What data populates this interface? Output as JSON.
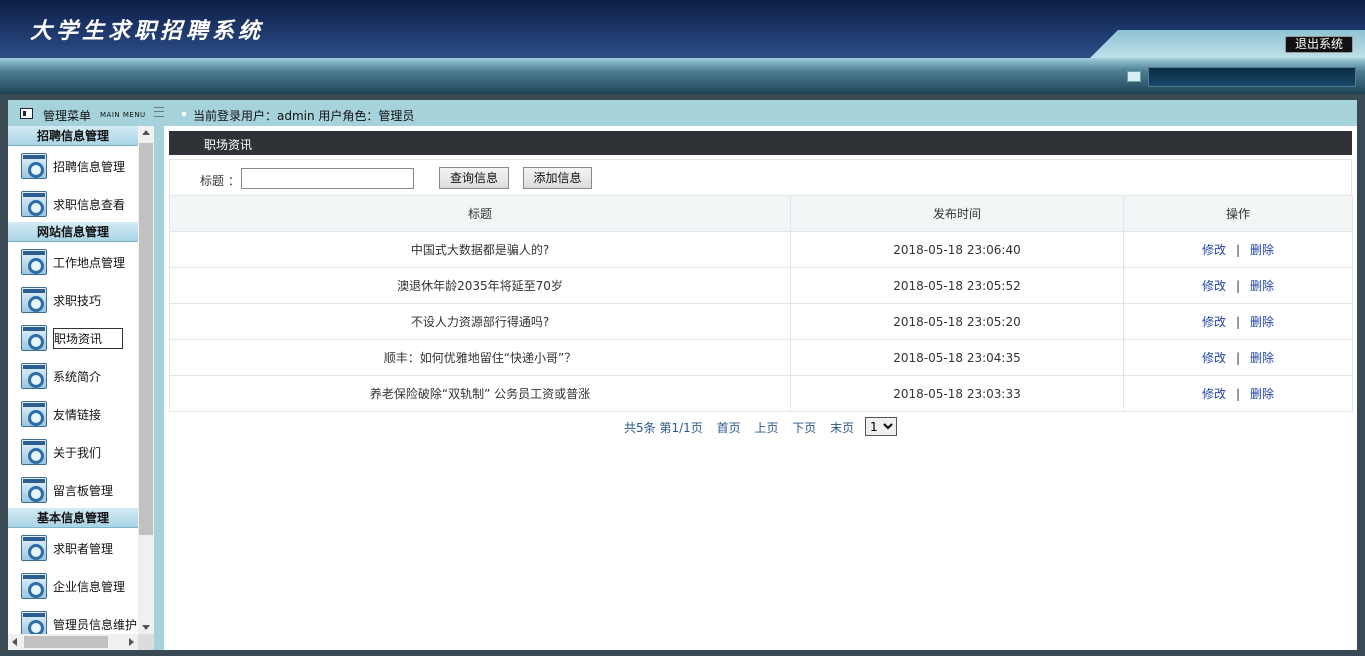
{
  "header": {
    "title": "大学生求职招聘系统",
    "logout_label": "退出系统"
  },
  "strip": {
    "menu_title": "管理菜单",
    "menu_sub": "MAIN MENU",
    "user_info": "当前登录用户：admin  用户角色：管理员"
  },
  "sidebar": {
    "groups": [
      {
        "title": "招聘信息管理",
        "items": [
          "招聘信息管理",
          "求职信息查看"
        ]
      },
      {
        "title": "网站信息管理",
        "items": [
          "工作地点管理",
          "求职技巧",
          "职场资讯",
          "系统简介",
          "友情链接",
          "关于我们",
          "留言板管理"
        ]
      },
      {
        "title": "基本信息管理",
        "items": [
          "求职者管理",
          "企业信息管理",
          "管理员信息维护"
        ]
      }
    ],
    "active_item": "职场资讯"
  },
  "panel": {
    "title": "职场资讯",
    "search_label": "标题 ：",
    "search_value": "",
    "query_button": "查询信息",
    "add_button": "添加信息"
  },
  "table": {
    "headers": [
      "标题",
      "发布时间",
      "操作"
    ],
    "rows": [
      {
        "title": "中国式大数据都是骗人的?",
        "time": "2018-05-18 23:06:40"
      },
      {
        "title": "澳退休年龄2035年将延至70岁",
        "time": "2018-05-18 23:05:52"
      },
      {
        "title": "不设人力资源部行得通吗?",
        "time": "2018-05-18 23:05:20"
      },
      {
        "title": "顺丰：如何优雅地留住“快递小哥”？",
        "time": "2018-05-18 23:04:35"
      },
      {
        "title": "养老保险破除“双轨制” 公务员工资或普涨",
        "time": "2018-05-18 23:03:33"
      }
    ],
    "edit_label": "修改",
    "sep": "|",
    "delete_label": "删除"
  },
  "pager": {
    "summary": "共5条 第1/1页",
    "first": "首页",
    "prev": "上页",
    "next": "下页",
    "last": "末页",
    "current_page": "1"
  }
}
